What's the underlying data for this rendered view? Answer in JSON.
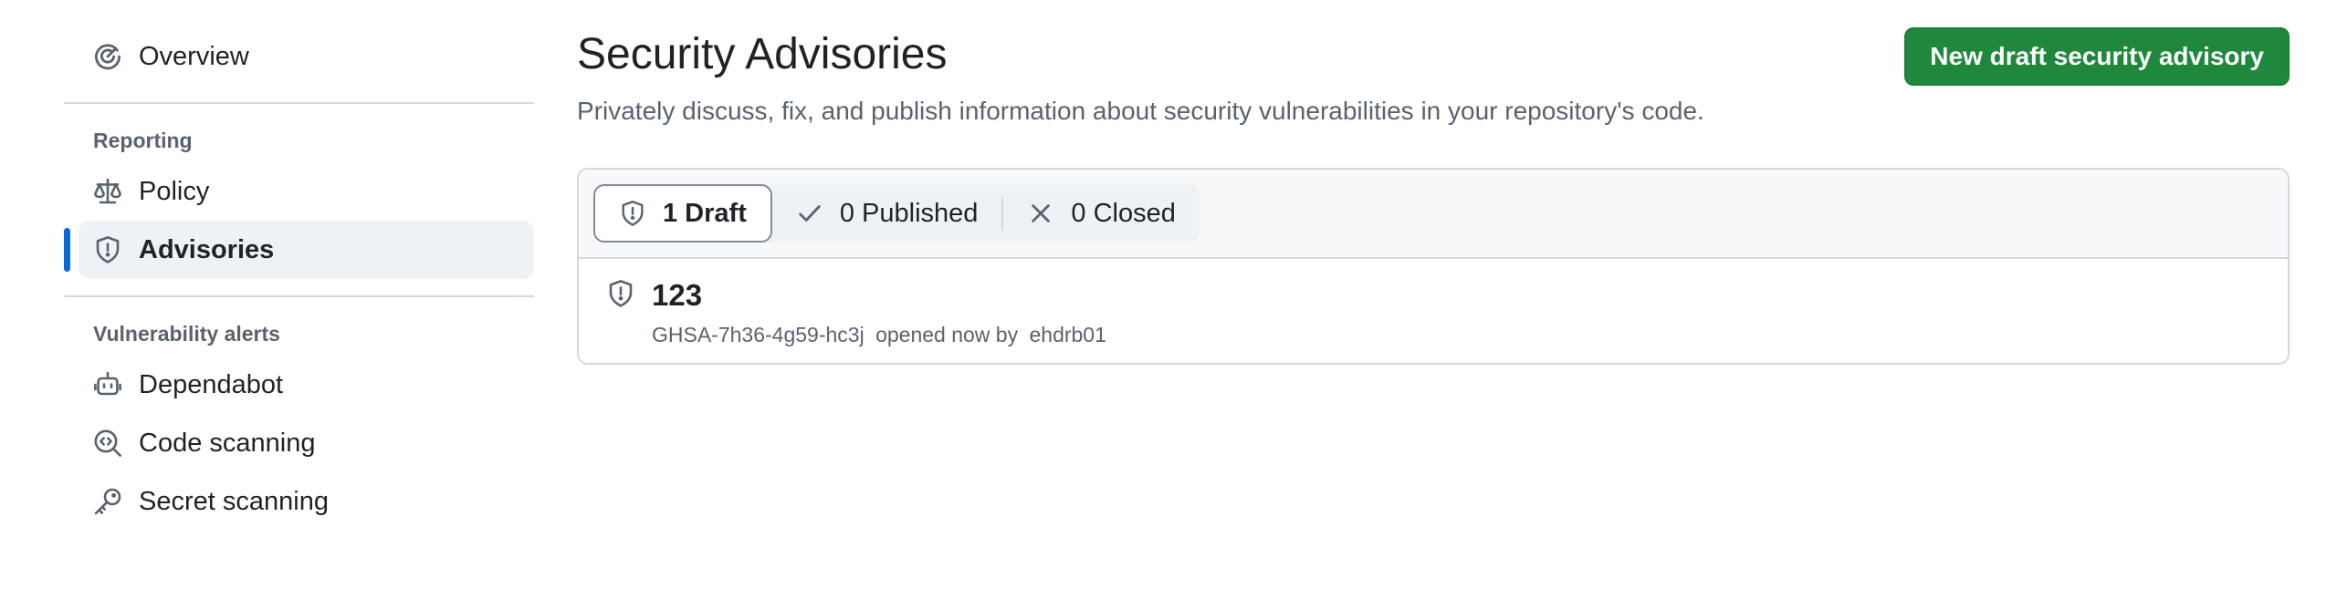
{
  "sidebar": {
    "overview": {
      "label": "Overview",
      "icon": "meter-icon"
    },
    "reporting": {
      "heading": "Reporting",
      "items": [
        {
          "label": "Policy",
          "icon": "law-icon"
        },
        {
          "label": "Advisories",
          "icon": "shield-icon",
          "active": true
        }
      ]
    },
    "vulnerability_alerts": {
      "heading": "Vulnerability alerts",
      "items": [
        {
          "label": "Dependabot",
          "icon": "dependabot-icon"
        },
        {
          "label": "Code scanning",
          "icon": "codescan-icon"
        },
        {
          "label": "Secret scanning",
          "icon": "key-icon"
        }
      ]
    },
    "active_color": "#0969da"
  },
  "main": {
    "title": "Security Advisories",
    "description": "Privately discuss, fix, and publish information about security vulnerabilities in your repository's code.",
    "new_button_label": "New draft security advisory",
    "button_color": "#1f883d",
    "filters": [
      {
        "label": "1 Draft",
        "icon": "shield-icon",
        "selected": true
      },
      {
        "label": "0 Published",
        "icon": "check-icon"
      },
      {
        "label": "0 Closed",
        "icon": "x-icon"
      }
    ],
    "advisories": [
      {
        "title": "123",
        "ghsa_id": "GHSA-7h36-4g59-hc3j",
        "status_text": "opened now by",
        "author": "ehdrb01",
        "icon": "shield-icon"
      }
    ]
  }
}
